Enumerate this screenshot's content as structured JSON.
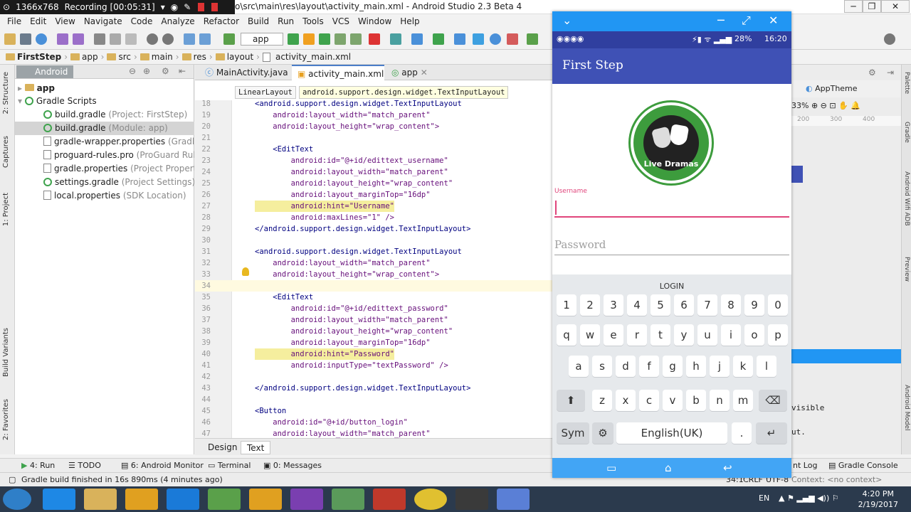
{
  "recorder": {
    "resolution": "1366x768",
    "recording": "Recording [00:05:31]"
  },
  "window": {
    "title": "o\\src\\main\\res\\layout\\activity_main.xml - Android Studio 2.3 Beta 4",
    "minimize": "─",
    "maximize": "❐",
    "close": "✕"
  },
  "menu": [
    "File",
    "Edit",
    "View",
    "Navigate",
    "Code",
    "Analyze",
    "Refactor",
    "Build",
    "Run",
    "Tools",
    "VCS",
    "Window",
    "Help"
  ],
  "toolbar": {
    "run_config": "app"
  },
  "breadcrumbs": [
    "FirstStep",
    "app",
    "src",
    "main",
    "res",
    "layout",
    "activity_main.xml"
  ],
  "left_stripe": [
    "1: Project",
    "Captures",
    "2: Structure",
    "Build Variants",
    "2: Favorites"
  ],
  "project_panel": {
    "view_mode": "Android",
    "items": [
      {
        "name": "app",
        "extra": ""
      },
      {
        "name": "Gradle Scripts",
        "extra": ""
      },
      {
        "name": "build.gradle",
        "extra": "(Project: FirstStep)"
      },
      {
        "name": "build.gradle",
        "extra": "(Module: app)"
      },
      {
        "name": "gradle-wrapper.properties",
        "extra": "(Gradle Versi"
      },
      {
        "name": "proguard-rules.pro",
        "extra": "(ProGuard Rules for"
      },
      {
        "name": "gradle.properties",
        "extra": "(Project Properties)"
      },
      {
        "name": "settings.gradle",
        "extra": "(Project Settings)"
      },
      {
        "name": "local.properties",
        "extra": "(SDK Location)"
      }
    ]
  },
  "editor_tabs": [
    "MainActivity.java",
    "activity_main.xml",
    "app"
  ],
  "hint_tags": [
    "LinearLayout",
    "android.support.design.widget.TextInputLayout"
  ],
  "code_lines": [
    {
      "n": "18",
      "t": "<android.support.design.widget.TextInputLayout"
    },
    {
      "n": "19",
      "t": "    android:layout_width=\"match_parent\""
    },
    {
      "n": "20",
      "t": "    android:layout_height=\"wrap_content\">"
    },
    {
      "n": "21",
      "t": ""
    },
    {
      "n": "22",
      "t": "    <EditText"
    },
    {
      "n": "23",
      "t": "        android:id=\"@+id/edittext_username\""
    },
    {
      "n": "24",
      "t": "        android:layout_width=\"match_parent\""
    },
    {
      "n": "25",
      "t": "        android:layout_height=\"wrap_content\""
    },
    {
      "n": "26",
      "t": "        android:layout_marginTop=\"16dp\""
    },
    {
      "n": "27",
      "t": "        android:hint=\"Username\""
    },
    {
      "n": "28",
      "t": "        android:maxLines=\"1\" />"
    },
    {
      "n": "29",
      "t": "</android.support.design.widget.TextInputLayout>"
    },
    {
      "n": "30",
      "t": ""
    },
    {
      "n": "31",
      "t": "<android.support.design.widget.TextInputLayout"
    },
    {
      "n": "32",
      "t": "    android:layout_width=\"match_parent\""
    },
    {
      "n": "33",
      "t": "    android:layout_height=\"wrap_content\">"
    },
    {
      "n": "34",
      "t": ""
    },
    {
      "n": "35",
      "t": "    <EditText"
    },
    {
      "n": "36",
      "t": "        android:id=\"@+id/edittext_password\""
    },
    {
      "n": "37",
      "t": "        android:layout_width=\"match_parent\""
    },
    {
      "n": "38",
      "t": "        android:layout_height=\"wrap_content\""
    },
    {
      "n": "39",
      "t": "        android:layout_marginTop=\"16dp\""
    },
    {
      "n": "40",
      "t": "        android:hint=\"Password\""
    },
    {
      "n": "41",
      "t": "        android:inputType=\"textPassword\" />"
    },
    {
      "n": "42",
      "t": ""
    },
    {
      "n": "43",
      "t": "</android.support.design.widget.TextInputLayout>"
    },
    {
      "n": "44",
      "t": ""
    },
    {
      "n": "45",
      "t": "<Button"
    },
    {
      "n": "46",
      "t": "    android:id=\"@+id/button_login\""
    },
    {
      "n": "47",
      "t": "    android:layout_width=\"match_parent\""
    }
  ],
  "design_tabs": [
    "Design",
    "Text"
  ],
  "preview": {
    "theme": "AppTheme",
    "zoom": "33%",
    "ruler": [
      "200",
      "300",
      "400"
    ],
    "snippet1": "visible",
    "snippet2": "ut."
  },
  "right_stripe": [
    "Palette",
    "Gradle",
    "Android Wifi ADB",
    "Preview",
    "Android Model"
  ],
  "bottom_tools": [
    "4: Run",
    "TODO",
    "6: Android Monitor",
    "Terminal",
    "0: Messages",
    "nt Log",
    "Gradle Console"
  ],
  "status": {
    "message": "Gradle build finished in 16s 890ms (4 minutes ago)",
    "position": "34:1",
    "line_sep": "CRLF",
    "encoding": "UTF-8",
    "context": "Context: <no context>"
  },
  "phone": {
    "status_time": "16:20",
    "battery": "28%",
    "app_title": "First Step",
    "logo_text": "Live Dramas",
    "username_label": "Username",
    "password_hint": "Password",
    "keyboard_title": "LOGIN",
    "row1": [
      "1",
      "2",
      "3",
      "4",
      "5",
      "6",
      "7",
      "8",
      "9",
      "0"
    ],
    "row2": [
      "q",
      "w",
      "e",
      "r",
      "t",
      "y",
      "u",
      "i",
      "o",
      "p"
    ],
    "row3": [
      "a",
      "s",
      "d",
      "f",
      "g",
      "h",
      "j",
      "k",
      "l"
    ],
    "row4": [
      "z",
      "x",
      "c",
      "v",
      "b",
      "n",
      "m"
    ],
    "sym": "Sym",
    "space": "English(UK)",
    "dot": ".",
    "shift": "⬆",
    "backspace": "⌫",
    "enter": "↵",
    "settings": "⚙"
  },
  "taskbar": {
    "lang": "EN",
    "time": "4:20 PM",
    "date": "2/19/2017"
  }
}
